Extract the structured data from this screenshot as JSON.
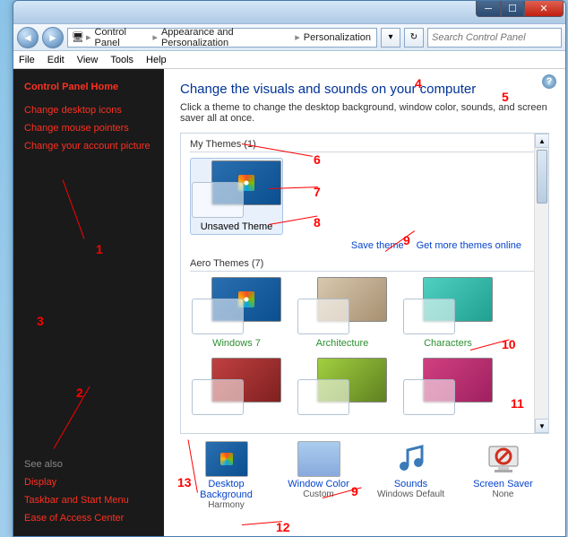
{
  "window": {
    "breadcrumb": [
      "Control Panel",
      "Appearance and Personalization",
      "Personalization"
    ],
    "search_placeholder": "Search Control Panel"
  },
  "menubar": [
    "File",
    "Edit",
    "View",
    "Tools",
    "Help"
  ],
  "sidebar": {
    "home": "Control Panel Home",
    "links": [
      "Change desktop icons",
      "Change mouse pointers",
      "Change your account picture"
    ],
    "seealso_label": "See also",
    "seealso": [
      "Display",
      "Taskbar and Start Menu",
      "Ease of Access Center"
    ]
  },
  "main": {
    "title": "Change the visuals and sounds on your computer",
    "subtitle": "Click a theme to change the desktop background, window color, sounds, and screen saver all at once.",
    "my_themes_label": "My Themes (1)",
    "my_themes": [
      {
        "name": "Unsaved Theme"
      }
    ],
    "save_theme": "Save theme",
    "get_more": "Get more themes online",
    "aero_label": "Aero Themes (7)",
    "aero": [
      {
        "name": "Windows 7",
        "cls": "win"
      },
      {
        "name": "Architecture",
        "cls": "arch"
      },
      {
        "name": "Characters",
        "cls": "char"
      },
      {
        "name": "",
        "cls": "land"
      },
      {
        "name": "",
        "cls": "nat"
      },
      {
        "name": "",
        "cls": "scn"
      }
    ]
  },
  "bottom": {
    "bg": {
      "label": "Desktop Background",
      "value": "Harmony"
    },
    "wc": {
      "label": "Window Color",
      "value": "Custom"
    },
    "snd": {
      "label": "Sounds",
      "value": "Windows Default"
    },
    "scr": {
      "label": "Screen Saver",
      "value": "None"
    }
  },
  "annotations": [
    "1",
    "2",
    "3",
    "4",
    "5",
    "6",
    "7",
    "8",
    "9",
    "9",
    "10",
    "11",
    "12",
    "13"
  ]
}
